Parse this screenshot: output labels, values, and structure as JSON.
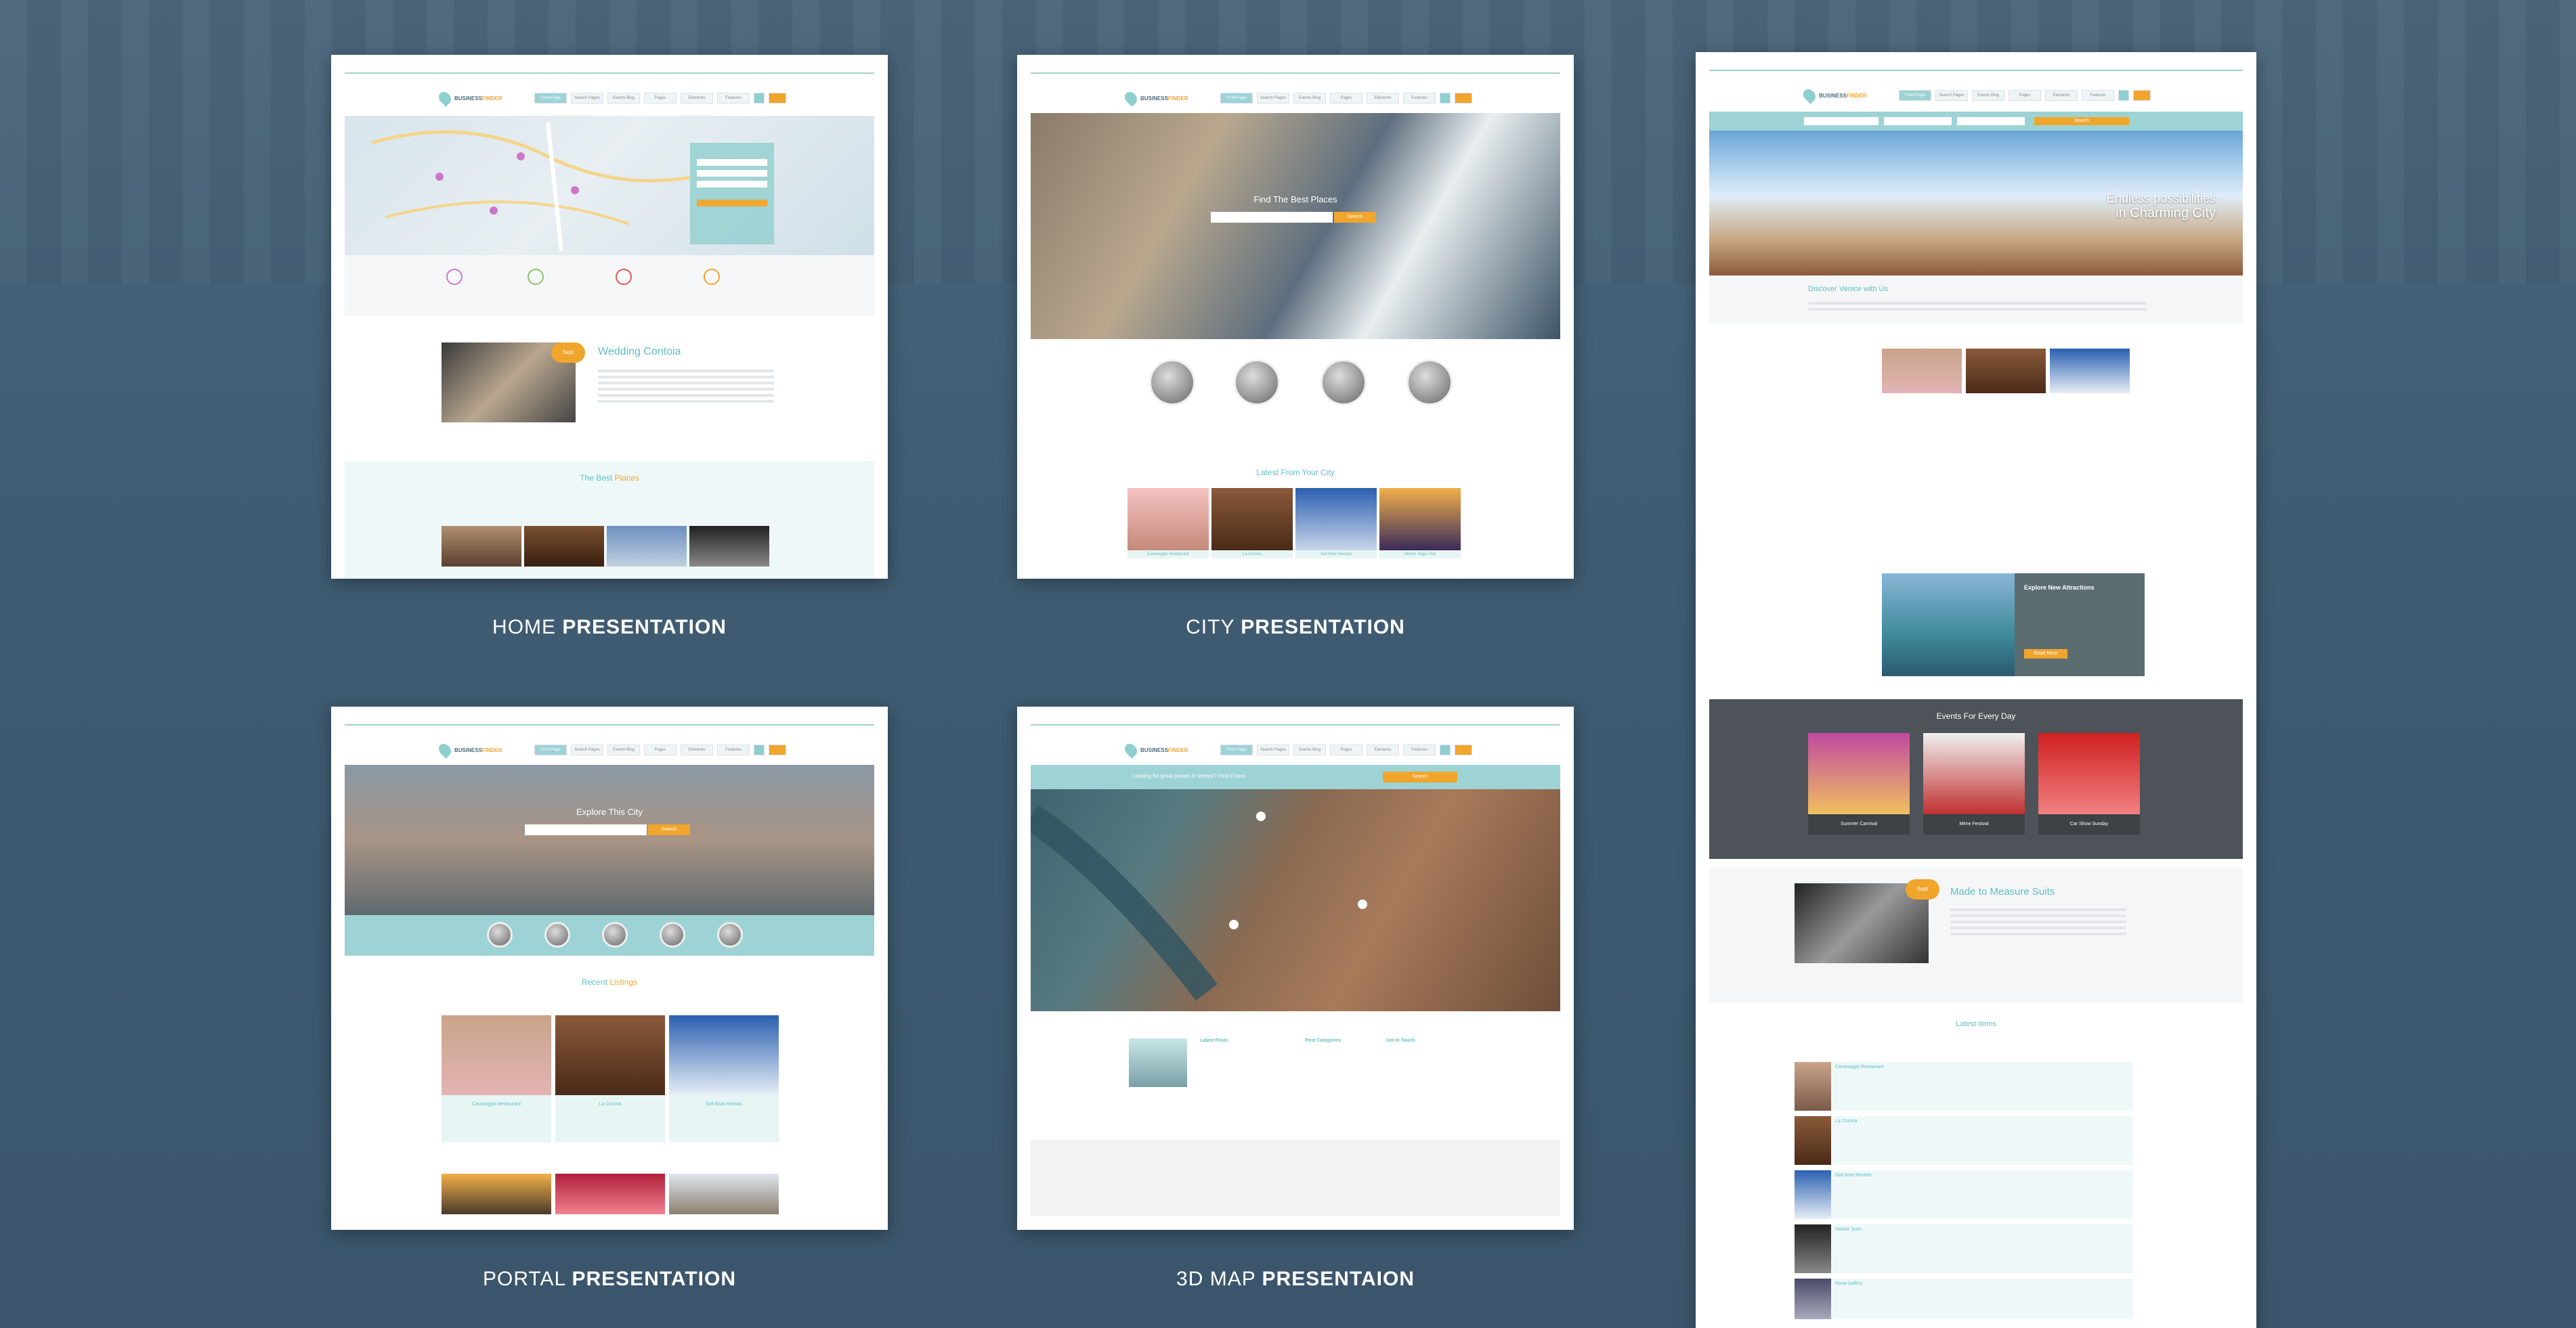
{
  "captions": {
    "home": {
      "normal": "HOME ",
      "bold": "PRESENTATION"
    },
    "city": {
      "normal": "CITY ",
      "bold": "PRESENTATION"
    },
    "portal": {
      "normal": "PORTAL ",
      "bold": "PRESENTATION"
    },
    "map3d": {
      "normal": "3D MAP ",
      "bold": "PRESENTAION"
    }
  },
  "site": {
    "brand": "BUSINESS",
    "brand_accent": "FINDER",
    "menu": [
      "Front Page",
      "Search Pages",
      "Events Blog",
      "Pages",
      "Elements",
      "Features"
    ]
  },
  "home": {
    "feature_title": "Wedding Contoia",
    "badge": "Sept",
    "section_title_a": "The Best",
    "section_title_b": "Places"
  },
  "city": {
    "hero_title": "Find The Best Places",
    "search_button": "Search",
    "section_title": "Latest From Your City",
    "thumb_labels": [
      "Caravaggio Restaurant",
      "La Corona",
      "Sail Boat Rentals",
      "Venice Yoga Club"
    ]
  },
  "portal": {
    "hero_title": "Explore This City",
    "search_button": "Search",
    "section_title_a": "Recent",
    "section_title_b": "Listings",
    "thumb_labels": [
      "Caravaggio Restaurant",
      "La Corona",
      "Sail Boat Rentals"
    ]
  },
  "map3d": {
    "banner": "Looking for great places in Venice? Find it here",
    "banner_button": "Search",
    "cols": [
      "Latest Posts",
      "Post Categories",
      "Get In Touch"
    ]
  },
  "tall": {
    "hero_title_a": "Endless possibilities",
    "hero_title_b": "in Charming City",
    "intro_title": "Discover Venice with Us",
    "search_button": "Search",
    "explore_title": "Explore New Attractions",
    "explore_button": "Read More",
    "events_title": "Events For Every Day",
    "events": [
      "Summer Carnival",
      "Mime Festival",
      "Car Show Sunday"
    ],
    "feature_title": "Made to Measure Suits",
    "badge": "Sept",
    "latest_title": "Latest Items",
    "list_items": [
      "Caravaggio Restaurant",
      "La Corona",
      "Sail Boat Rentals",
      "Harbor Suits",
      "Nova Gallery"
    ]
  }
}
